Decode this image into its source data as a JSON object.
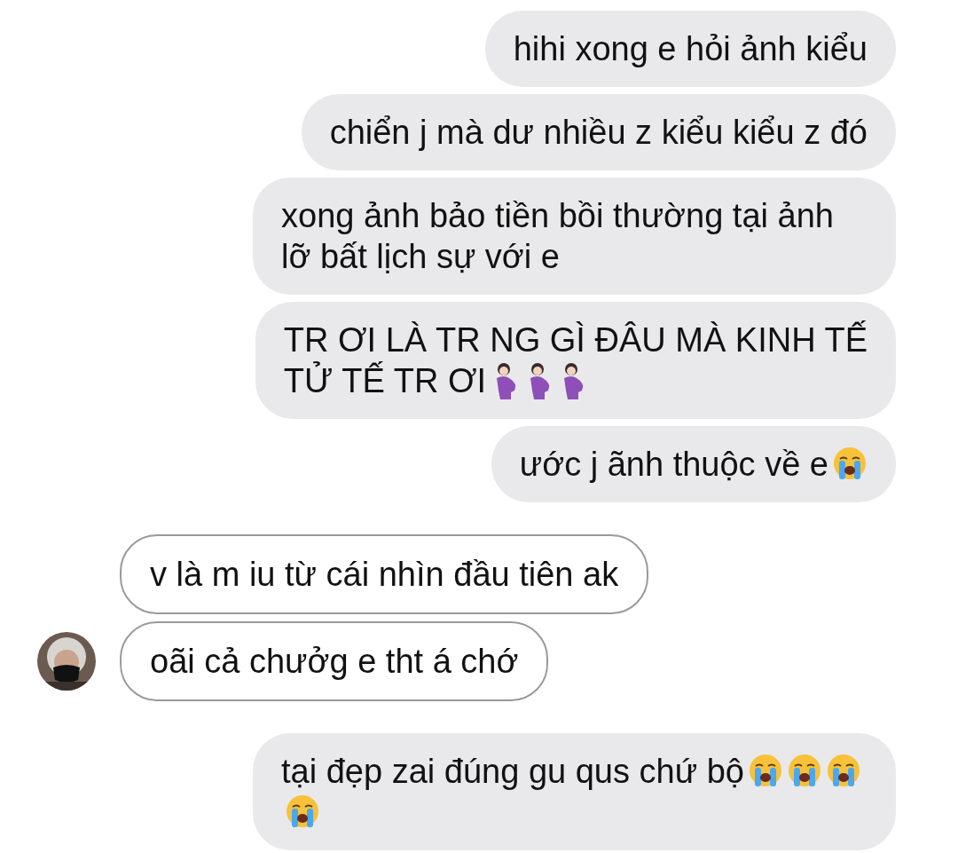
{
  "messages": [
    {
      "kind": "sent",
      "parts": [
        {
          "kind": "text",
          "text": "hihi xong e hỏi ảnh kiểu"
        }
      ]
    },
    {
      "kind": "sent",
      "parts": [
        {
          "kind": "text",
          "text": "chiển j mà dư nhiều z kiểu kiểu z đó"
        }
      ]
    },
    {
      "kind": "sent",
      "parts": [
        {
          "kind": "text",
          "text": "xong ảnh bảo tiền bồi thường tại ảnh lỡ bất lịch sự với e"
        }
      ]
    },
    {
      "kind": "sent",
      "parts": [
        {
          "kind": "text",
          "text": "TR ƠI LÀ TR NG GÌ ĐÂU MÀ KINH TẾ"
        },
        {
          "kind": "text",
          "text": "TỬ TẾ TR ƠI"
        },
        {
          "kind": "pregnant"
        },
        {
          "kind": "pregnant"
        },
        {
          "kind": "pregnant"
        }
      ]
    },
    {
      "kind": "sent",
      "parts": [
        {
          "kind": "text",
          "text": "ước j ãnh thuộc về e"
        },
        {
          "kind": "crying"
        }
      ]
    },
    {
      "kind": "received",
      "parts": [
        {
          "kind": "text",
          "text": "v là m iu từ cái nhìn đầu tiên ak"
        }
      ]
    },
    {
      "kind": "received",
      "avatar": true,
      "parts": [
        {
          "kind": "text",
          "text": "oãi cả chưởg e tht á chớ"
        }
      ]
    },
    {
      "kind": "sent",
      "parts": [
        {
          "kind": "text",
          "text": "tại đẹp zai đúng gu qus chứ bộ"
        },
        {
          "kind": "crying"
        },
        {
          "kind": "crying"
        },
        {
          "kind": "crying"
        },
        {
          "kind": "crying"
        }
      ]
    }
  ]
}
